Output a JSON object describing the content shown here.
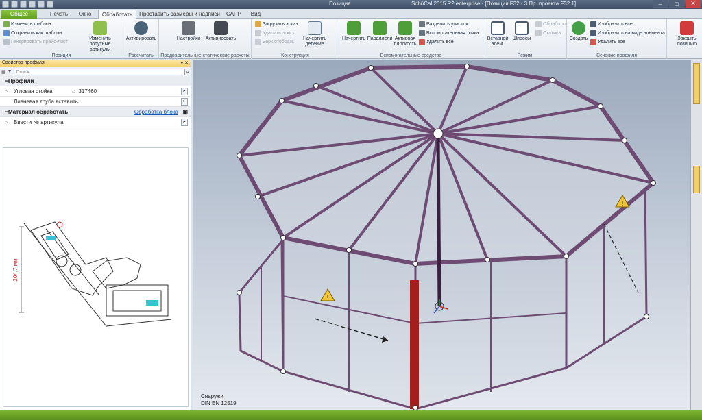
{
  "window": {
    "title_center": "Позиция",
    "title_right": "SchüCal 2015 R2 enterprise - [Позиция F32 - 3 Пр. проекта F32 1]"
  },
  "ribbon_tabs": [
    "Общее",
    "Печать",
    "Окно",
    "Обработать",
    "Проставить размеры и надписи",
    "САПР",
    "Вид"
  ],
  "ribbon": {
    "position": {
      "label": "Позиция",
      "change_template": "Изменить шаблон",
      "save_as_template": "Сохранить как шаблон",
      "generate_price_list": "Генерировать прайс-лист",
      "change_articles": "Изменить попутные артикулы"
    },
    "calculate": {
      "label": "Рассчитать",
      "activate": "Активировать"
    },
    "statics": {
      "label": "Предварительные статические расчеты",
      "settings": "Настройки",
      "activate": "Активировать"
    },
    "construction": {
      "label": "Конструкция",
      "load_sketch": "Загрузить эскиз",
      "delete_sketch": "Удалить эскиз",
      "mirror": "Зерк.отображ.",
      "draw_division": "Начертить деление"
    },
    "aux": {
      "label": "Вспомогательные средства",
      "draw": "Начертить",
      "parallels": "Параллели",
      "active_plane": "Активная плоскость",
      "split_section": "Разделить участок",
      "aux_point": "Вспомогательная точка",
      "delete_all": "Удалить все"
    },
    "mode": {
      "label": "Режим",
      "insert_element": "Вставной элем.",
      "muntins": "Шпросы",
      "processing": "Обработка",
      "statics": "Статика"
    },
    "section": {
      "label": "Сечение профиля",
      "create": "Создать",
      "show_all": "Изобразить все",
      "show_as_element": "Изобразить на виде элемента",
      "delete_all": "Удалить все"
    },
    "close": {
      "label": "Закрыть позицию"
    }
  },
  "panel": {
    "title": "Свойства профиля",
    "pin": "▾ ✕",
    "search_placeholder": "Поиск",
    "categories": {
      "profiles": "Профили",
      "material": "Материал обработать",
      "material_link": "Обработка блока"
    },
    "rows": {
      "corner_post": "Угловая стойка",
      "corner_post_value": "317460",
      "gutter": "Ливневая труба вставить",
      "article": "Ввести № артикула"
    },
    "drawing": {
      "dimension": "204,7 мм"
    }
  },
  "viewport": {
    "caption_line1": "Снаружи",
    "caption_line2": "DIN EN 12519"
  },
  "colors": {
    "brand_green": "#6aab24",
    "frame_profile": "#7a5a7e",
    "highlight_post": "#a51e1e"
  }
}
